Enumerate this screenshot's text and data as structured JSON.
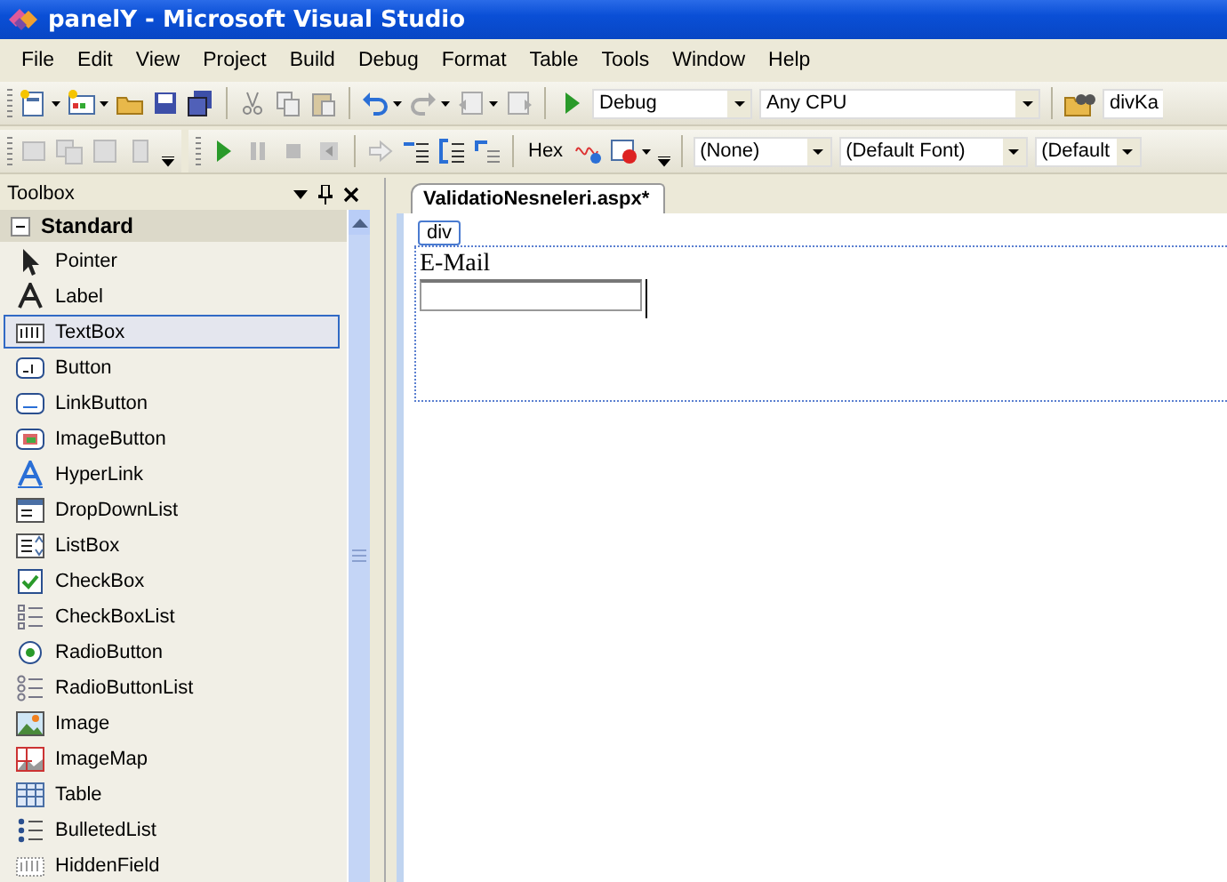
{
  "window": {
    "title": "panelY - Microsoft Visual Studio"
  },
  "menu": [
    "File",
    "Edit",
    "View",
    "Project",
    "Build",
    "Debug",
    "Format",
    "Table",
    "Tools",
    "Window",
    "Help"
  ],
  "standard_toolbar": {
    "configuration": "Debug",
    "platform": "Any CPU",
    "find": "divKa"
  },
  "format_toolbar": {
    "hex_button": "Hex",
    "block_format": "(None)",
    "font_name": "(Default Font)",
    "font_size": "(Default"
  },
  "toolbox": {
    "title": "Toolbox",
    "group": {
      "label": "Standard",
      "expanded": true
    },
    "items": [
      {
        "label": "Pointer",
        "selected": false
      },
      {
        "label": "Label",
        "selected": false
      },
      {
        "label": "TextBox",
        "selected": true
      },
      {
        "label": "Button",
        "selected": false
      },
      {
        "label": "LinkButton",
        "selected": false
      },
      {
        "label": "ImageButton",
        "selected": false
      },
      {
        "label": "HyperLink",
        "selected": false
      },
      {
        "label": "DropDownList",
        "selected": false
      },
      {
        "label": "ListBox",
        "selected": false
      },
      {
        "label": "CheckBox",
        "selected": false
      },
      {
        "label": "CheckBoxList",
        "selected": false
      },
      {
        "label": "RadioButton",
        "selected": false
      },
      {
        "label": "RadioButtonList",
        "selected": false
      },
      {
        "label": "Image",
        "selected": false
      },
      {
        "label": "ImageMap",
        "selected": false
      },
      {
        "label": "Table",
        "selected": false
      },
      {
        "label": "BulletedList",
        "selected": false
      },
      {
        "label": "HiddenField",
        "selected": false
      }
    ]
  },
  "document_tab": {
    "label": "ValidatioNesneleri.aspx*",
    "selected": true
  },
  "designer": {
    "tag": "div",
    "label": "E-Mail"
  }
}
